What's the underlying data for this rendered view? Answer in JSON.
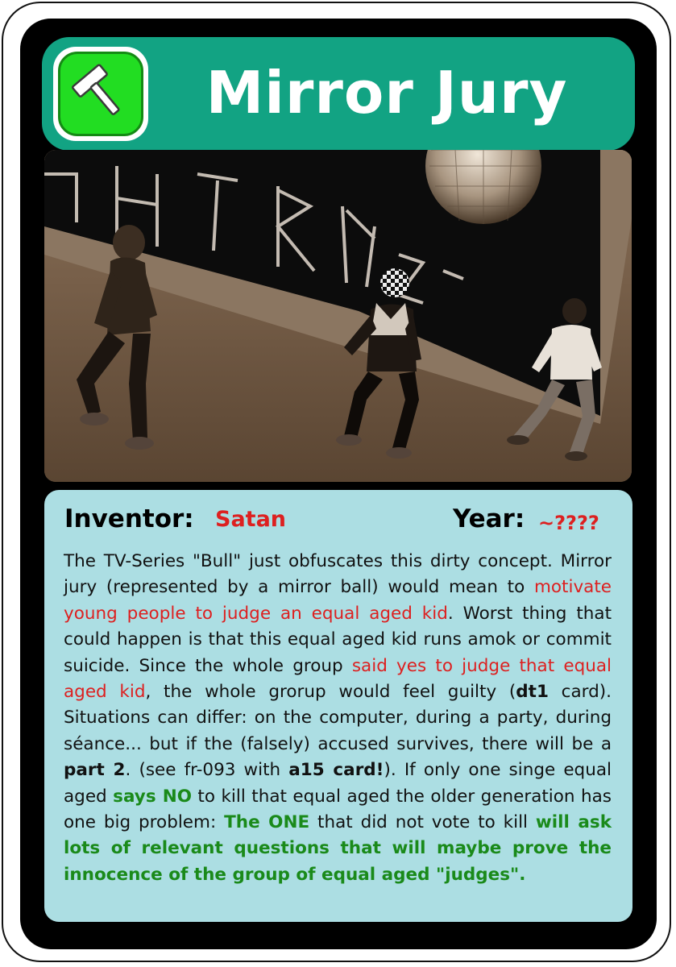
{
  "card": {
    "title": "Mirror Jury",
    "logo_icon": "hammer-icon",
    "colors": {
      "header": "#12a383",
      "logo_green": "#22dd22",
      "info_panel": "#acdee3",
      "red_text": "#dd2020",
      "green_text": "#1a8a1a"
    }
  },
  "info": {
    "inventor_label": "Inventor:",
    "inventor_value": "Satan",
    "year_label": "Year:",
    "year_value": "~????"
  },
  "description": {
    "s1": "The TV-Series \"Bull\" just obfuscates this dirty concept. Mirror jury (represented by a mirror ball) would mean to ",
    "s2": "motivate young people to judge an equal aged kid",
    "s3": ". Worst thing that could happen is that this equal aged kid runs amok or commit suicide. Since the whole group ",
    "s4": "said yes to judge that equal aged kid",
    "s5": ", the whole grorup would feel guilty (",
    "s6": "dt1",
    "s7": " card). Situations can differ: on the computer, during a party, during séance... but if the (falsely) accused survives, there will be a ",
    "s8": "part 2",
    "s9": ". (see fr-093 with ",
    "s10": "a15 card!",
    "s11": "). If only one singe equal aged ",
    "s12": "says NO",
    "s13": " to kill that equal aged the older generation has one big problem: ",
    "s14": "The ONE",
    "s15": " that did not vote to kill ",
    "s16": "will ask lots of relevant questions that will maybe prove the innocence of the group of equal aged \"judges\"."
  }
}
